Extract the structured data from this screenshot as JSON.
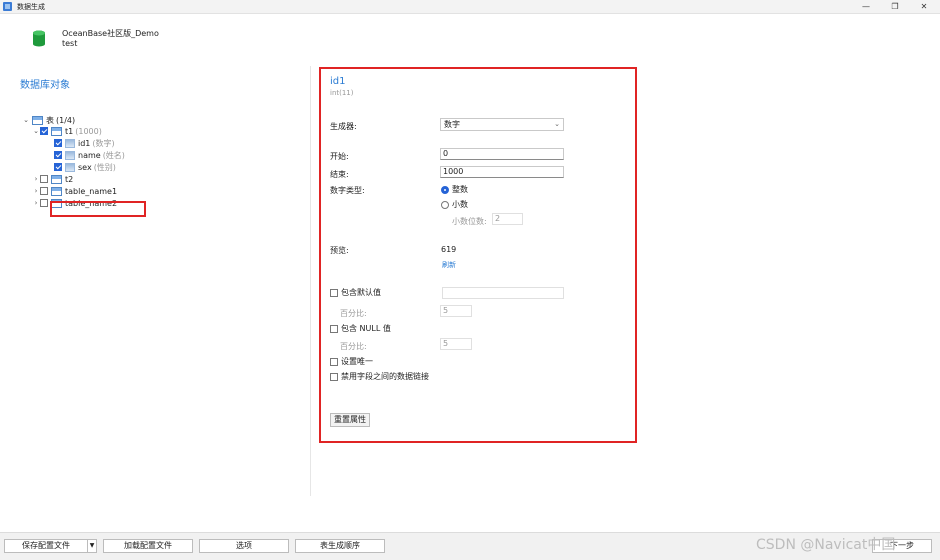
{
  "window": {
    "title": "数据生成",
    "minimize": "—",
    "maximize": "❐",
    "close": "✕"
  },
  "header": {
    "connection_name": "OceanBase社区版_Demo",
    "database_name": "test"
  },
  "left_pane": {
    "title": "数据库对象",
    "tree": {
      "root": {
        "label": "表",
        "hint": "(1/4)"
      },
      "items": [
        {
          "label": "t1",
          "hint": "(1000)"
        },
        {
          "label": "id1",
          "hint": "(数字)"
        },
        {
          "label": "name",
          "hint": "(姓名)"
        },
        {
          "label": "sex",
          "hint": "(性别)"
        },
        {
          "label": "t2",
          "hint": ""
        },
        {
          "label": "table_name1",
          "hint": ""
        },
        {
          "label": "table_name2",
          "hint": ""
        }
      ]
    }
  },
  "detail": {
    "field_name": "id1",
    "field_type": "int(11)",
    "generator_label": "生成器:",
    "generator_value": "数字",
    "start_label": "开始:",
    "start_value": "0",
    "end_label": "结束:",
    "end_value": "1000",
    "number_type_label": "数字类型:",
    "integer_option": "整数",
    "decimal_option": "小数",
    "decimal_places_label": "小数位数:",
    "decimal_places_value": "2",
    "preview_label": "预览:",
    "preview_value": "619",
    "refresh_link": "刷新",
    "include_default_label": "包含默认值",
    "default_value": "",
    "default_percent_label": "百分比:",
    "default_percent_value": "5",
    "include_null_label": "包含 NULL 值",
    "null_percent_label": "百分比:",
    "null_percent_value": "5",
    "unique_label": "设置唯一",
    "disable_link_label": "禁用字段之间的数据链接",
    "reset_button": "重置属性"
  },
  "footer": {
    "save_config": "保存配置文件",
    "save_dropdown": "▼",
    "load_config": "加载配置文件",
    "options": "选项",
    "order": "表生成顺序",
    "next": "下一步"
  },
  "watermark": "CSDN @Navicat中国"
}
